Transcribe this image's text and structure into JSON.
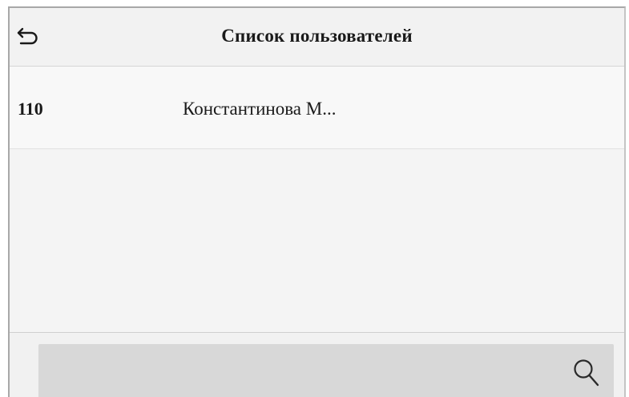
{
  "header": {
    "title": "Список пользователей",
    "back_icon": "back-arrow-icon"
  },
  "users": [
    {
      "id": "110",
      "name": "Константинова М..."
    }
  ],
  "search": {
    "icon": "search-icon",
    "value": ""
  }
}
